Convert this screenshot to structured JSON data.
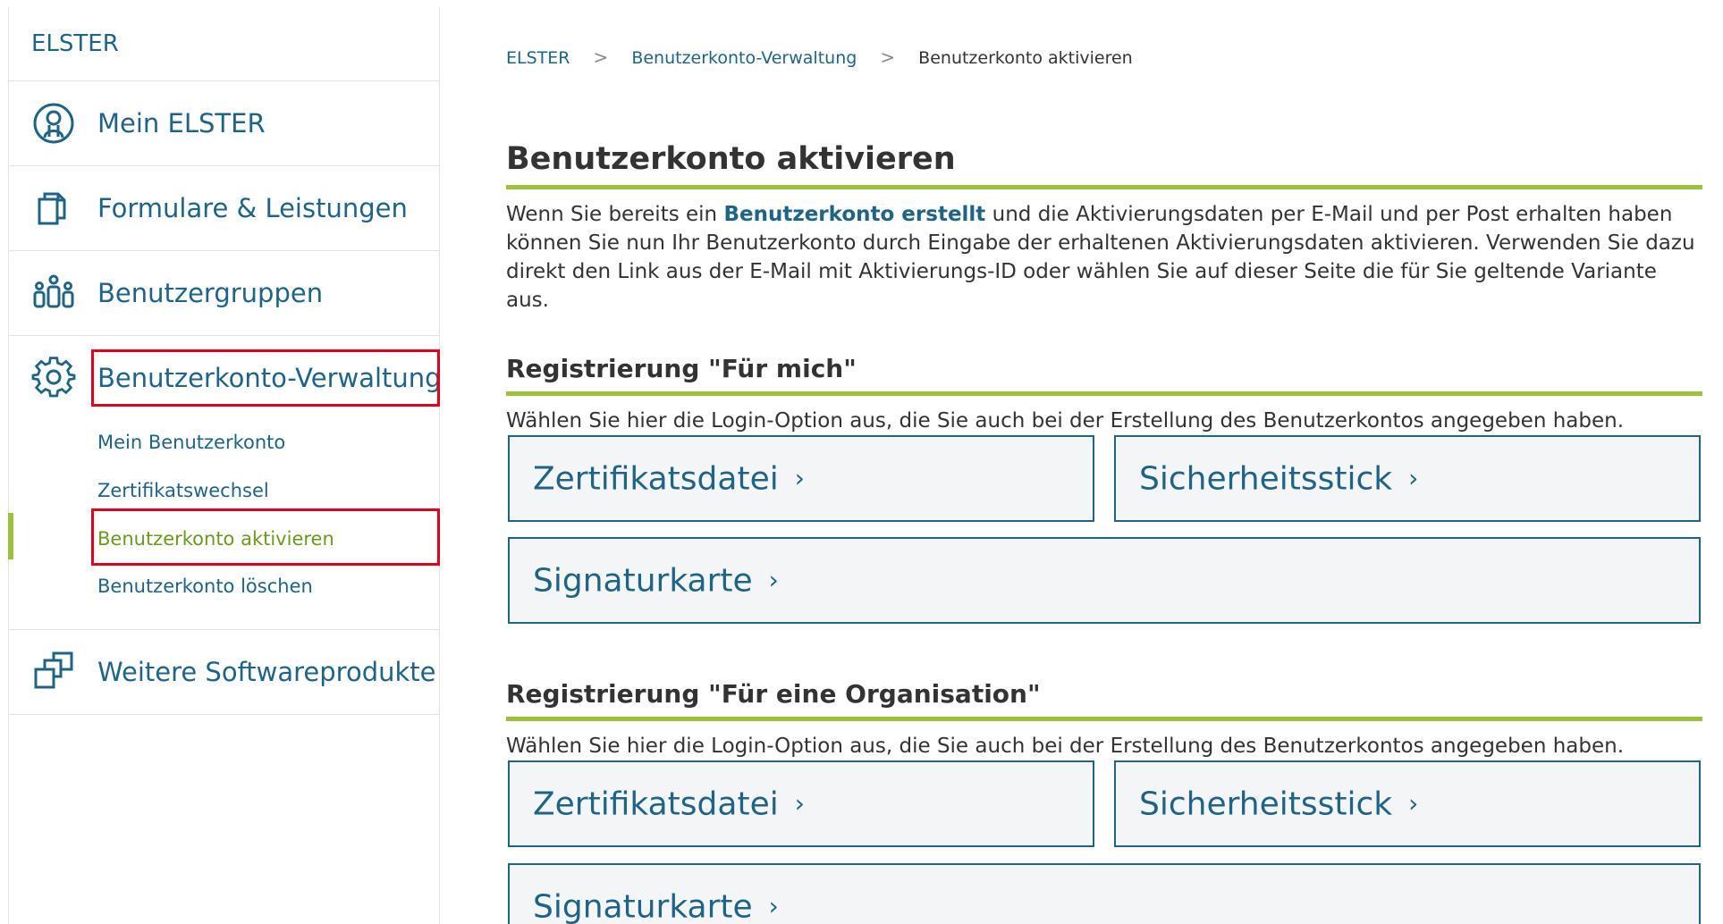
{
  "sidebar": {
    "brand": "ELSTER",
    "items": [
      {
        "label": "Mein ELSTER",
        "icon": "user-circle-icon"
      },
      {
        "label": "Formulare & Leistungen",
        "icon": "documents-icon"
      },
      {
        "label": "Benutzergruppen",
        "icon": "user-group-icon"
      },
      {
        "label": "Benutzerkonto-Verwaltung",
        "icon": "gear-icon"
      },
      {
        "label": "Weitere Softwareprodukte",
        "icon": "software-products-icon"
      }
    ],
    "subitems": [
      {
        "label": "Mein Benutzerkonto"
      },
      {
        "label": "Zertifikatswechsel"
      },
      {
        "label": "Benutzerkonto aktivieren",
        "active": true
      },
      {
        "label": "Benutzerkonto löschen"
      }
    ]
  },
  "breadcrumb": {
    "items": [
      "ELSTER",
      "Benutzerkonto-Verwaltung",
      "Benutzerkonto aktivieren"
    ],
    "separator": ">"
  },
  "main": {
    "title": "Benutzerkonto aktivieren",
    "intro_before": "Wenn Sie bereits ein ",
    "intro_link": "Benutzerkonto erstellt",
    "intro_after": " und die Aktivierungsdaten per E-Mail und per Post erhalten haben können Sie nun Ihr Benutzerkonto durch Eingabe der erhaltenen Aktivierungsdaten aktivieren. Verwenden Sie dazu direkt den Link aus der E-Mail mit Aktivierungs-ID oder wählen Sie auf dieser Seite die für Sie geltende Variante aus.",
    "sections": [
      {
        "heading": "Registrierung \"Für mich\"",
        "hint": "Wählen Sie hier die Login-Option aus, die Sie auch bei der Erstellung des Benutzerkontos angegeben haben.",
        "options": [
          "Zertifikatsdatei",
          "Sicherheitsstick",
          "Signaturkarte"
        ]
      },
      {
        "heading": "Registrierung \"Für eine Organisation\"",
        "hint": "Wählen Sie hier die Login-Option aus, die Sie auch bei der Erstellung des Benutzerkontos angegeben haben.",
        "options": [
          "Zertifikatsdatei",
          "Sicherheitsstick",
          "Signaturkarte"
        ]
      }
    ],
    "chevron": "›"
  },
  "colors": {
    "link": "#1f6487",
    "accent_green": "#9dc13a",
    "active_sub": "#6b9a1f",
    "highlight_red": "#e2001a",
    "button_bg": "#f4f5f6"
  }
}
